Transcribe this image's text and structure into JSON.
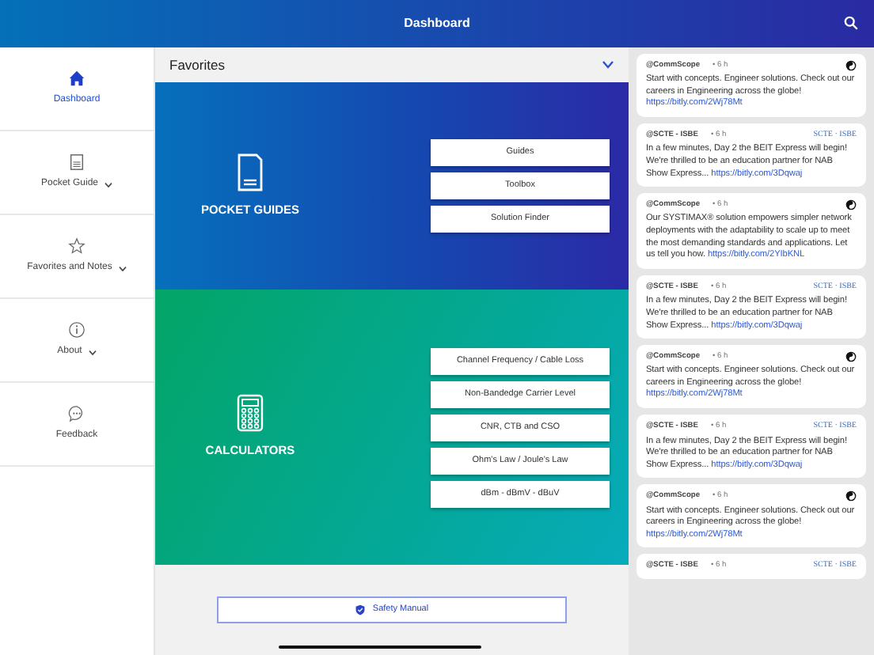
{
  "header": {
    "title": "Dashboard"
  },
  "sidebar": {
    "items": [
      {
        "label": "Dashboard",
        "selected": true,
        "expandable": false
      },
      {
        "label": "Pocket Guide",
        "selected": false,
        "expandable": true
      },
      {
        "label": "Favorites and Notes",
        "selected": false,
        "expandable": true
      },
      {
        "label": "About",
        "selected": false,
        "expandable": true
      },
      {
        "label": "Feedback",
        "selected": false,
        "expandable": false
      }
    ]
  },
  "favorites": {
    "title": "Favorites",
    "expanded": true
  },
  "sections": [
    {
      "kind": "guides",
      "title": "POCKET GUIDES",
      "buttons": [
        "Guides",
        "Toolbox",
        "Solution Finder"
      ]
    },
    {
      "kind": "calculators",
      "title": "CALCULATORS",
      "buttons": [
        "Channel Frequency / Cable Loss",
        "Non-Bandedge Carrier Level",
        "CNR, CTB and CSO",
        "Ohm's Law / Joule's Law",
        "dBm - dBmV - dBuV"
      ]
    }
  ],
  "safety_button": "Safety Manual",
  "feed": [
    {
      "handle": "@CommScope",
      "time": "• 6 h",
      "text": "Start with concepts. Engineer solutions. Check out our careers in Engineering across the globe!",
      "link": "https://bitly.com/2Wj78Mt"
    },
    {
      "handle": "@SCTE - ISBE",
      "time": "• 6 h",
      "logo": "SCTE · ISBE",
      "text": "In a few minutes, Day 2 the BEIT Express will begin!   We're thrilled to be an education partner for NAB Show Express...",
      "link": "https://bitly.com/3Dqwaj"
    },
    {
      "handle": "@CommScope",
      "time": "• 6 h",
      "text": "Our SYSTIMAX® solution empowers simpler network deployments with the adaptability to scale up to meet the most demanding standards and applications. Let us tell you how.",
      "link": "https://bitly.com/2YIbKNL"
    },
    {
      "handle": "@SCTE - ISBE",
      "time": "• 6 h",
      "logo": "SCTE · ISBE",
      "text": "In a few minutes, Day 2 the BEIT Express will begin!   We're thrilled to be an education partner for NAB Show Express...",
      "link": "https://bitly.com/3Dqwaj"
    },
    {
      "handle": "@CommScope",
      "time": "• 6 h",
      "text": "Start with concepts. Engineer solutions. Check out our careers in Engineering across the globe!",
      "link": "https://bitly.com/2Wj78Mt"
    },
    {
      "handle": "@SCTE - ISBE",
      "time": "• 6 h",
      "logo": "SCTE · ISBE",
      "text": "In a few minutes, Day 2 the BEIT Express will begin!   We're thrilled to be an education partner for NAB Show Express...",
      "link": "https://bitly.com/3Dqwaj"
    },
    {
      "handle": "@CommScope",
      "time": "• 6 h",
      "text": "Start with concepts. Engineer solutions. Check out our careers in Engineering across the globe!",
      "link": "https://bitly.com/2Wj78Mt"
    },
    {
      "handle": "@SCTE - ISBE",
      "time": "• 6 h",
      "logo": "SCTE · ISBE"
    }
  ]
}
